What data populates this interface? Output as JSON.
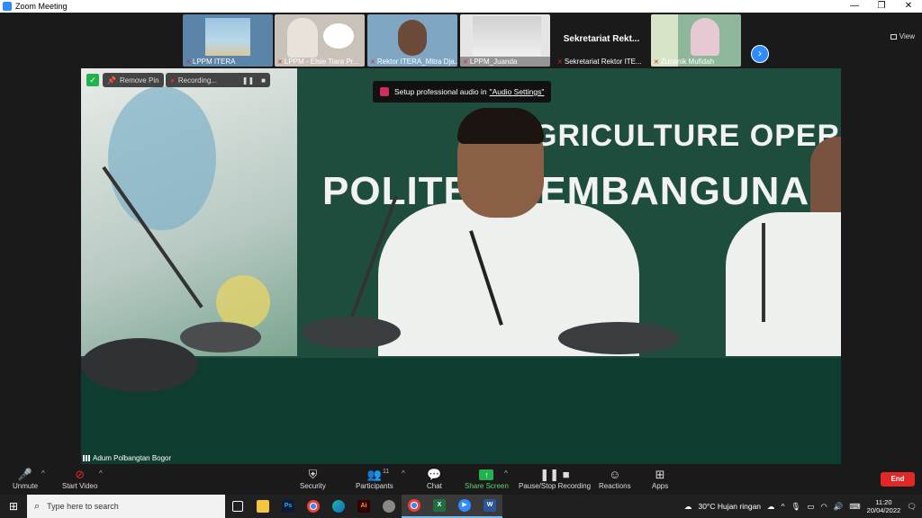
{
  "window": {
    "title": "Zoom Meeting",
    "controls": [
      "—",
      "❐",
      "✕"
    ]
  },
  "filmstrip": {
    "tiles": [
      {
        "name": "LPPM ITERA",
        "bg": "#5a84a8"
      },
      {
        "name": "LPPM - Elsie Tiara Pr...",
        "bg": "#c9c2b8"
      },
      {
        "name": "Rektor ITERA_Mitra Dja...",
        "bg": "#7fa7c4"
      },
      {
        "name": "LPPM_Juanda",
        "bg": "#e5e5e5"
      },
      {
        "name": "Sekretariat Rektor ITE...",
        "bg": "#1a1a1a",
        "big_text": "Sekretariat  Rekt..."
      },
      {
        "name": "Zunanik Mufidah",
        "bg": "#8fb79c"
      }
    ],
    "view_label": "View"
  },
  "main_video": {
    "remove_pin": "Remove Pin",
    "recording": "Recording...",
    "toast": {
      "text": "Setup professional audio in",
      "link": "\"Audio Settings\""
    },
    "banner_line1": "GRICULTURE OPERAT",
    "banner_line2": "POLITEK    PEMBANGUNAN",
    "speaker": "Adum Polbangtan Bogor"
  },
  "toolbar": {
    "unmute": "Unmute",
    "start_video": "Start Video",
    "security": "Security",
    "participants": "Participants",
    "participants_count": "11",
    "chat": "Chat",
    "share_screen": "Share Screen",
    "pause_recording": "Pause/Stop Recording",
    "reactions": "Reactions",
    "apps": "Apps",
    "end": "End"
  },
  "taskbar": {
    "search_placeholder": "Type here to search",
    "weather": "30°C  Hujan ringan",
    "time": "11:20",
    "date": "20/04/2022"
  }
}
